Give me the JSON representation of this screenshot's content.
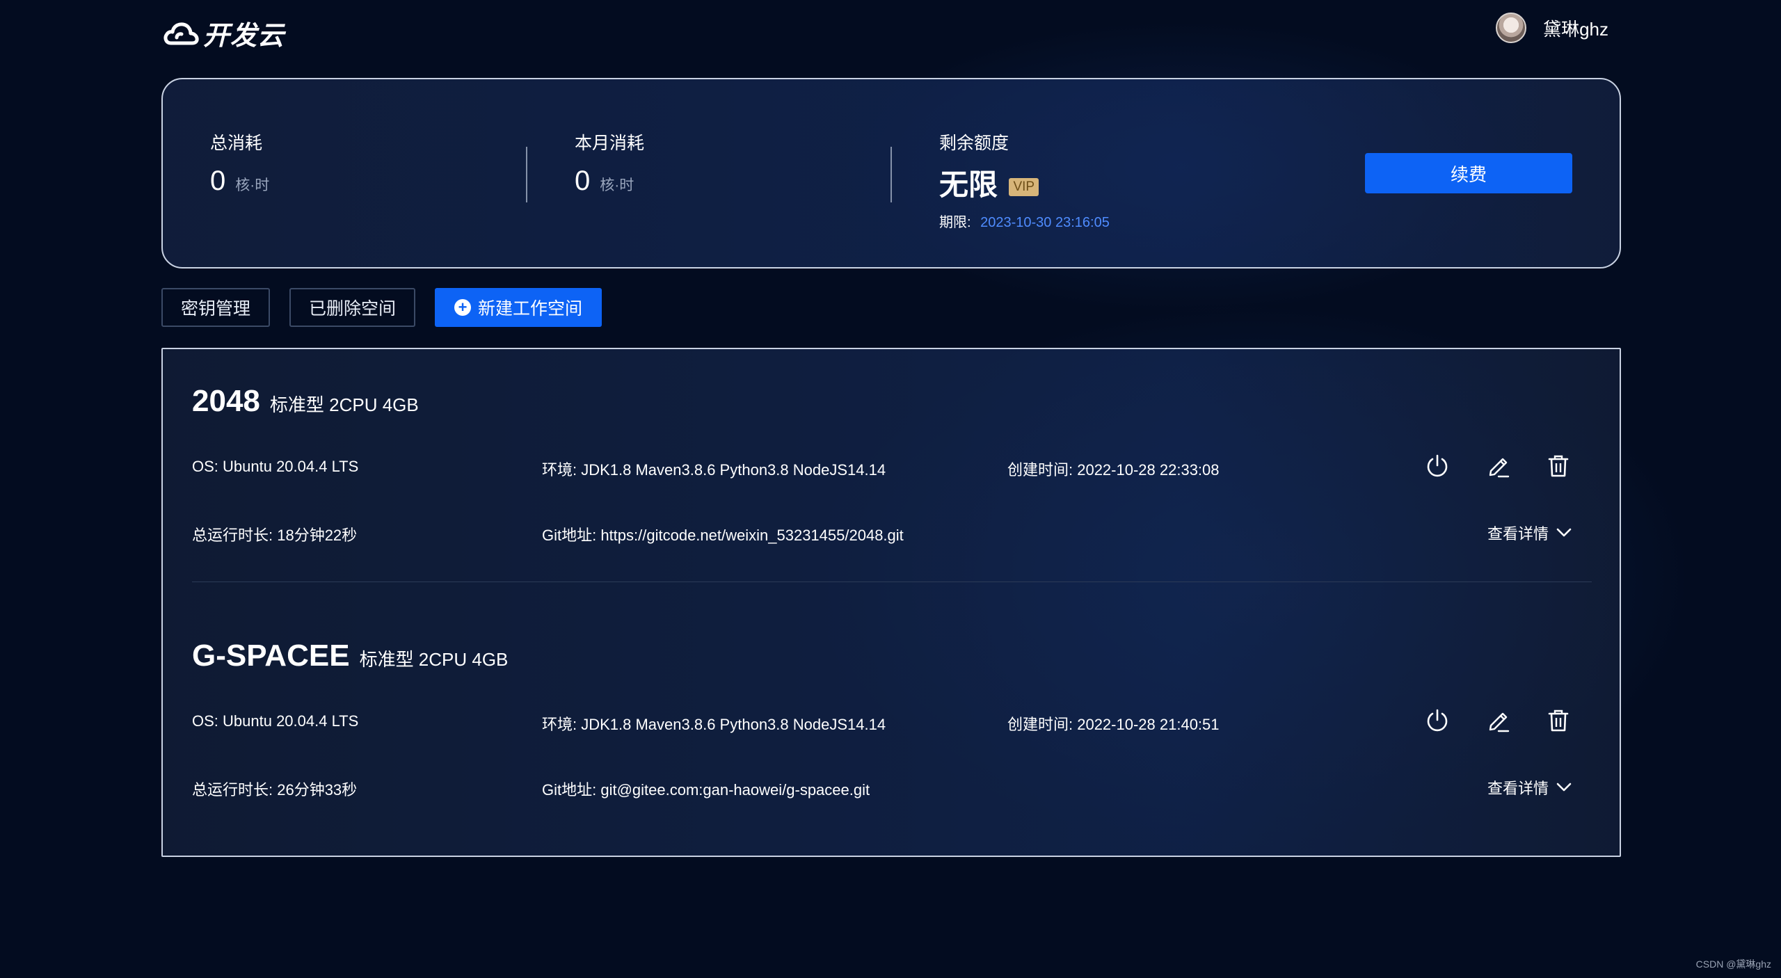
{
  "header": {
    "logo_text": "开发云",
    "user_name": "黛琳ghz"
  },
  "summary": {
    "total": {
      "label": "总消耗",
      "value": "0",
      "unit": "核·时"
    },
    "month": {
      "label": "本月消耗",
      "value": "0",
      "unit": "核·时"
    },
    "quota": {
      "label": "剩余额度",
      "value": "无限",
      "badge": "VIP",
      "expire_label": "期限:",
      "expire_date": "2023-10-30 23:16:05"
    },
    "renew_label": "续费"
  },
  "actions": {
    "key_mgmt": "密钥管理",
    "deleted": "已删除空间",
    "new_workspace": "新建工作空间"
  },
  "workspaces": [
    {
      "name": "2048",
      "spec": "标准型 2CPU 4GB",
      "os": "OS: Ubuntu 20.04.4 LTS",
      "env": "环境: JDK1.8 Maven3.8.6 Python3.8 NodeJS14.14",
      "created": "创建时间: 2022-10-28 22:33:08",
      "runtime": "总运行时长: 18分钟22秒",
      "git": "Git地址: https://gitcode.net/weixin_53231455/2048.git",
      "details_label": "查看详情"
    },
    {
      "name": "G-SPACEE",
      "spec": "标准型 2CPU 4GB",
      "os": "OS: Ubuntu 20.04.4 LTS",
      "env": "环境: JDK1.8 Maven3.8.6 Python3.8 NodeJS14.14",
      "created": "创建时间: 2022-10-28 21:40:51",
      "runtime": "总运行时长: 26分钟33秒",
      "git": "Git地址: git@gitee.com:gan-haowei/g-spacee.git",
      "details_label": "查看详情"
    }
  ],
  "watermark": "CSDN @黛琳ghz",
  "colors": {
    "accent": "#0d63f5",
    "link": "#4f8cff",
    "vip": "#d7b579",
    "background": "#030c20"
  }
}
